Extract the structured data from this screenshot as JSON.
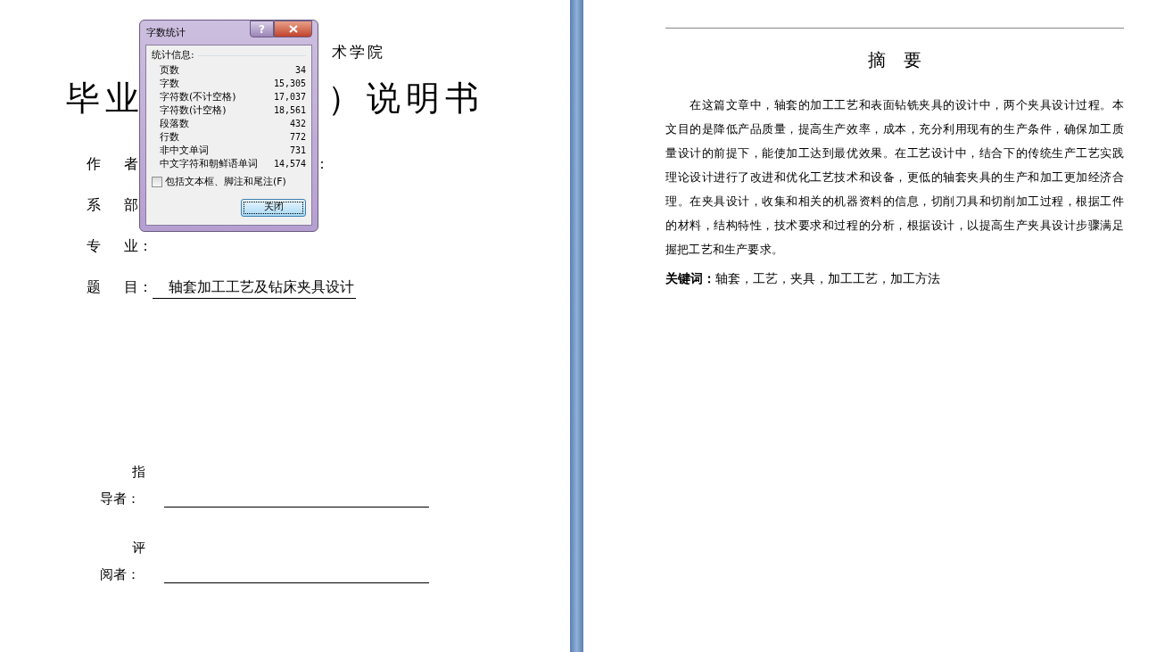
{
  "left_page": {
    "school_fragment": "术学院",
    "title_parts": [
      "毕业",
      "）说明书"
    ],
    "fields": [
      {
        "label": [
          "作",
          "者"
        ],
        "colon": "："
      },
      {
        "label": [
          "系",
          "部"
        ]
      },
      {
        "label": [
          "专",
          "业："
        ]
      },
      {
        "label": [
          "题",
          "目："
        ],
        "value": "轴套加工工艺及钻床夹具设计"
      }
    ],
    "signatures": [
      {
        "first": "指",
        "second": "导者："
      },
      {
        "first": "评",
        "second": "阅者："
      }
    ]
  },
  "dialog": {
    "title": "字数统计",
    "help": "?",
    "group_label": "统计信息:",
    "stats": [
      {
        "label": "页数",
        "value": "34"
      },
      {
        "label": "字数",
        "value": "15,305"
      },
      {
        "label": "字符数(不计空格)",
        "value": "17,037"
      },
      {
        "label": "字符数(计空格)",
        "value": "18,561"
      },
      {
        "label": "段落数",
        "value": "432"
      },
      {
        "label": "行数",
        "value": "772"
      },
      {
        "label": "非中文单词",
        "value": "731"
      },
      {
        "label": "中文字符和朝鲜语单词",
        "value": "14,574"
      }
    ],
    "checkbox": {
      "label": "包括文本框、脚注和尾注(F)",
      "checked": false
    },
    "close_button": "关闭"
  },
  "right_page": {
    "heading": "摘　要",
    "abstract": "在这篇文章中，轴套的加工工艺和表面钻铣夹具的设计中，两个夹具设计过程。本文目的是降低产品质量，提高生产效率，成本，充分利用现有的生产条件，确保加工质量设计的前提下，能使加工达到最优效果。在工艺设计中，结合下的传统生产工艺实践理论设计进行了改进和优化工艺技术和设备，更低的轴套夹具的生产和加工更加经济合理。在夹具设计，收集和相关的机器资料的信息，切削刀具和切削加工过程，根据工件的材料，结构特性，技术要求和过程的分析，根据设计，以提高生产夹具设计步骤满足握把工艺和生产要求。",
    "keywords_label": "关键词：",
    "keywords": "轴套，工艺，夹具，加工工艺，加工方法"
  }
}
